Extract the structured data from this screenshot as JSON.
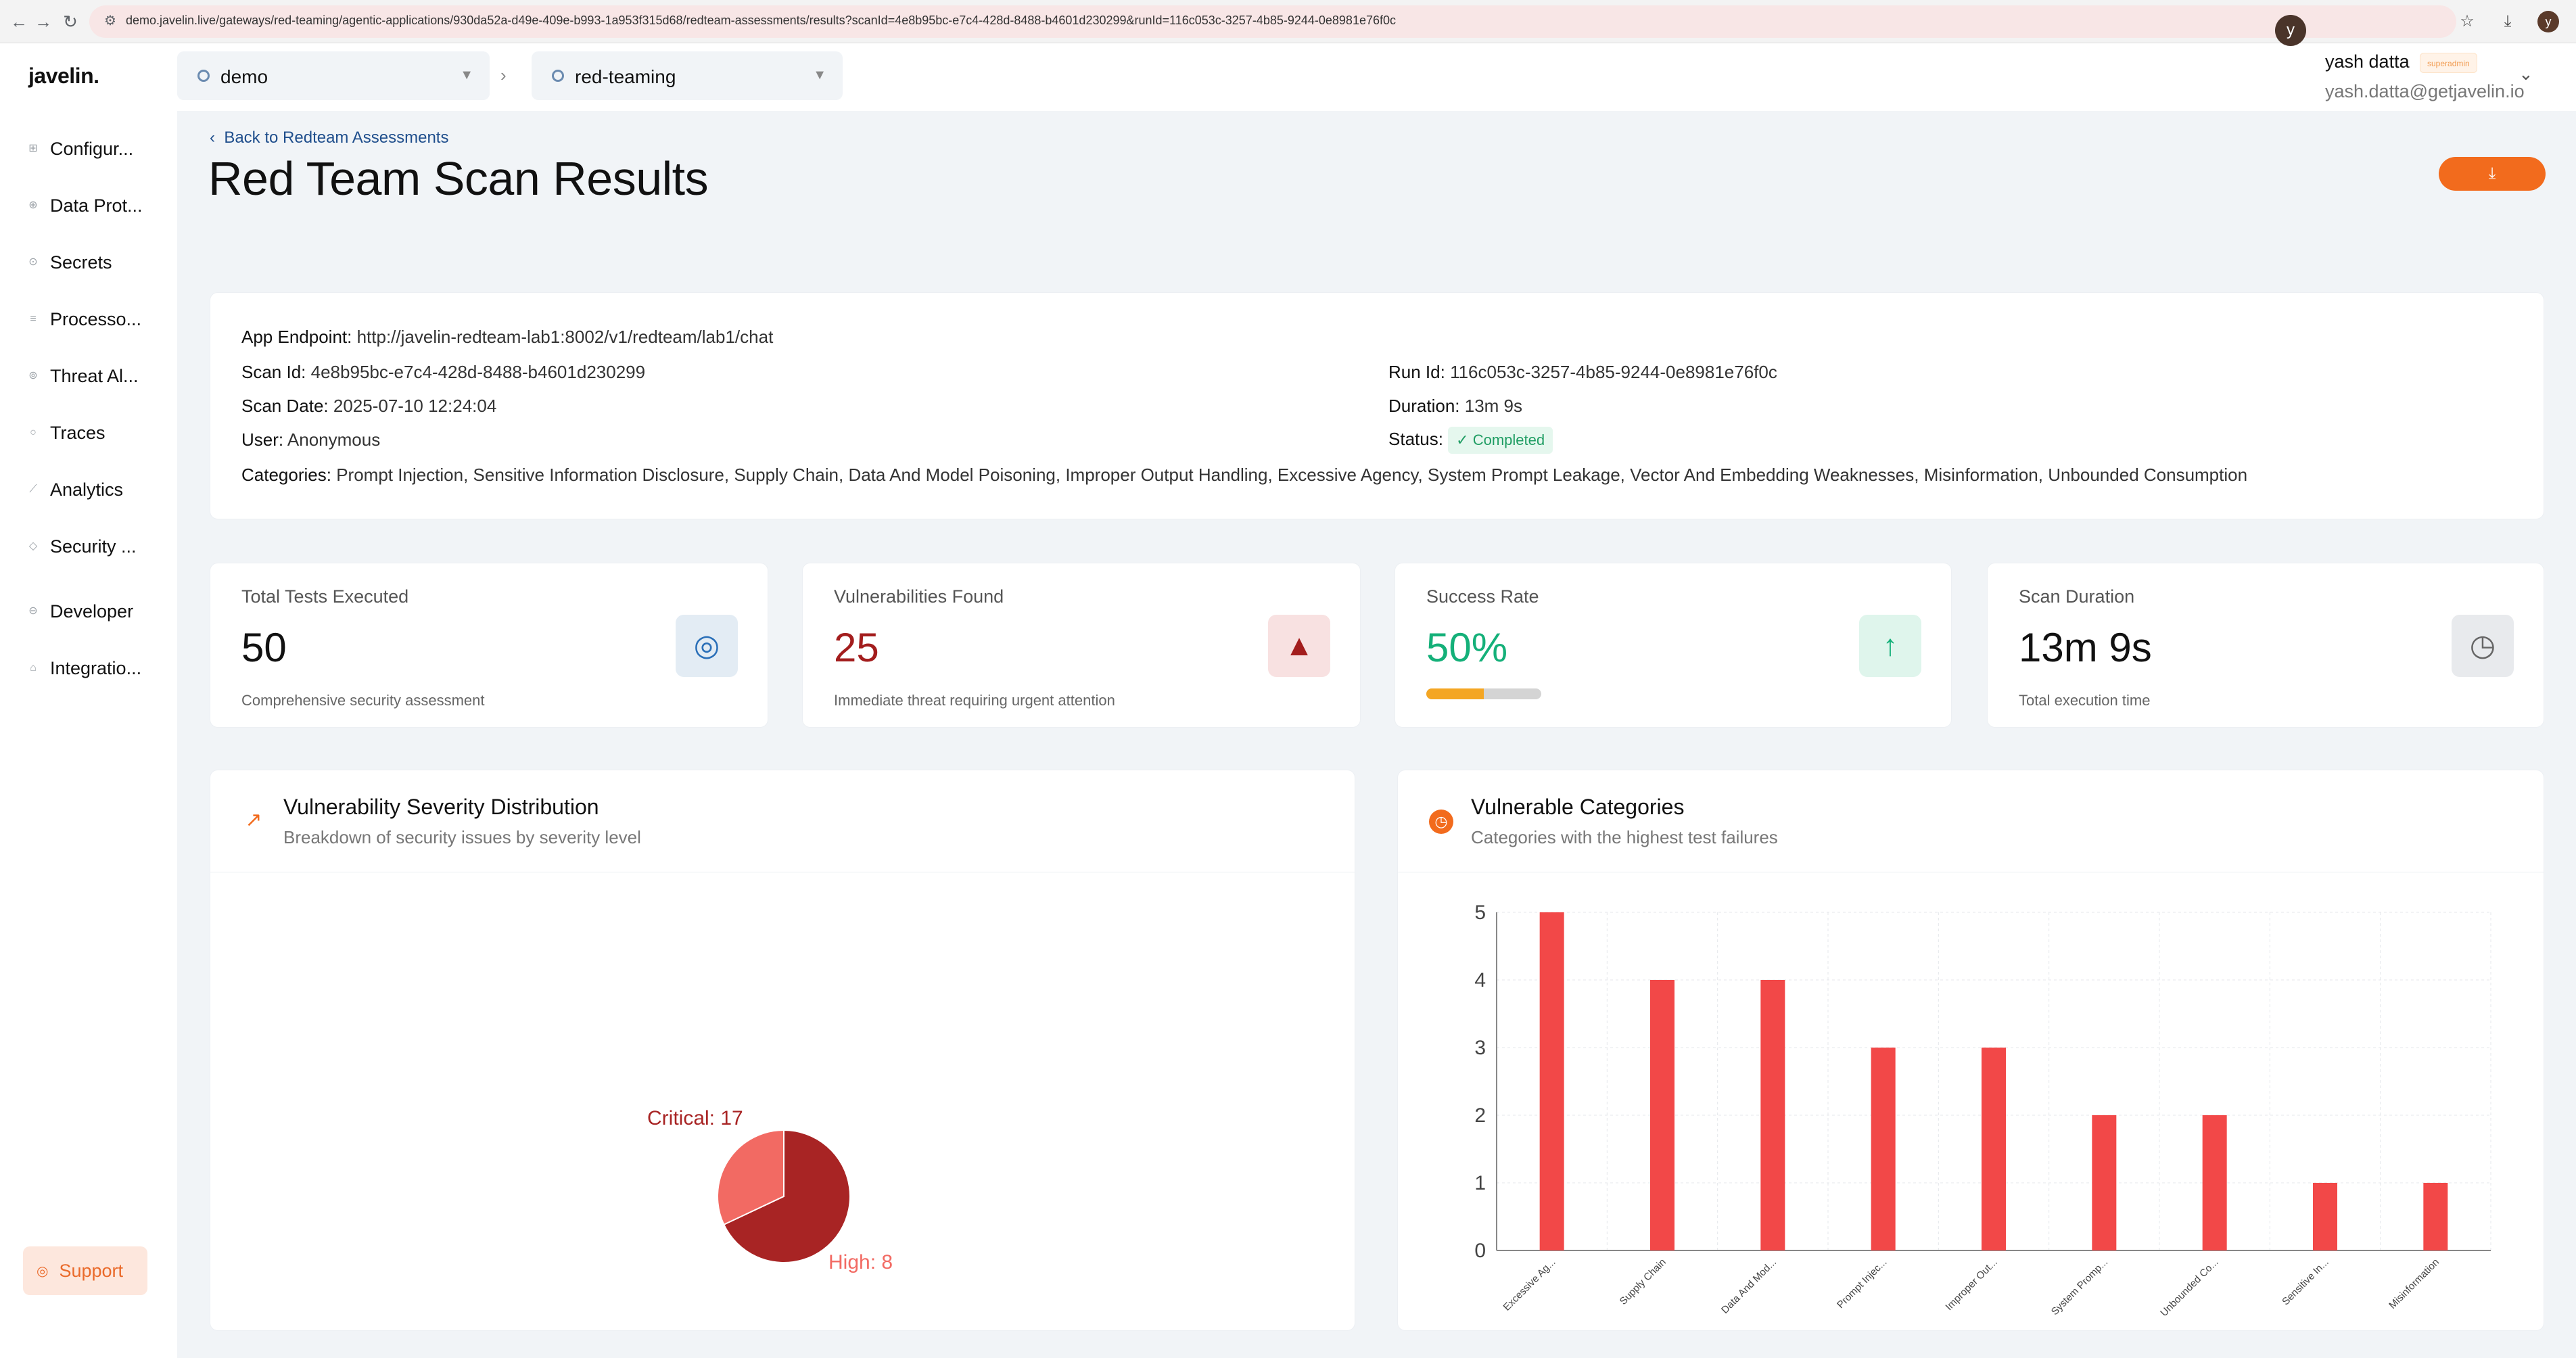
{
  "browser": {
    "url": "demo.javelin.live/gateways/red-teaming/agentic-applications/930da52a-d49e-409e-b993-1a953f315d68/redteam-assessments/results?scanId=4e8b95bc-e7c4-428d-8488-b4601d230299&runId=116c053c-3257-4b85-9244-0e8981e76f0c",
    "profile_initial": "y"
  },
  "app": {
    "logo": "javelin."
  },
  "sidebar": {
    "items": [
      {
        "label": "Configur...",
        "icon": "grid-icon"
      },
      {
        "label": "Data Prot...",
        "icon": "lock-icon"
      },
      {
        "label": "Secrets",
        "icon": "key-icon"
      },
      {
        "label": "Processo...",
        "icon": "list-icon"
      },
      {
        "label": "Threat Al...",
        "icon": "alert-icon"
      },
      {
        "label": "Traces",
        "icon": "trace-icon"
      },
      {
        "label": "Analytics",
        "icon": "chart-icon"
      },
      {
        "label": "Security ...",
        "icon": "shield-icon"
      },
      {
        "label": "Developer",
        "icon": "code-icon"
      },
      {
        "label": "Integratio...",
        "icon": "plug-icon"
      }
    ],
    "support_label": "Support"
  },
  "topbar": {
    "gateway": "demo",
    "application": "red-teaming",
    "user": {
      "initial": "y",
      "name": "yash datta",
      "role": "superadmin",
      "email": "yash.datta@getjavelin.io"
    }
  },
  "header": {
    "back_label": "Back to Redteam Assessments",
    "title": "Red Team Scan Results",
    "download_icon": "download-icon"
  },
  "scan_info": {
    "endpoint_label": "App Endpoint:",
    "endpoint": "http://javelin-redteam-lab1:8002/v1/redteam/lab1/chat",
    "scan_id_label": "Scan Id:",
    "scan_id": "4e8b95bc-e7c4-428d-8488-b4601d230299",
    "scan_date_label": "Scan Date:",
    "scan_date": "2025-07-10 12:24:04",
    "user_label": "User:",
    "user": "Anonymous",
    "run_id_label": "Run Id:",
    "run_id": "116c053c-3257-4b85-9244-0e8981e76f0c",
    "duration_label": "Duration:",
    "duration": "13m 9s",
    "status_label": "Status:",
    "status": "Completed",
    "categories_label": "Categories:",
    "categories": "Prompt Injection, Sensitive Information Disclosure, Supply Chain, Data And Model Poisoning, Improper Output Handling, Excessive Agency, System Prompt Leakage, Vector And Embedding Weaknesses, Misinformation, Unbounded Consumption"
  },
  "stats": [
    {
      "label": "Total Tests Executed",
      "value": "50",
      "sub": "Comprehensive security assessment",
      "icon": "target-icon",
      "value_color": "#111111"
    },
    {
      "label": "Vulnerabilities Found",
      "value": "25",
      "sub": "Immediate threat requiring urgent attention",
      "icon": "warning-icon",
      "value_color": "#a31d1d"
    },
    {
      "label": "Success Rate",
      "value": "50%",
      "progress": 0.5,
      "icon": "arrow-up-icon",
      "value_color": "#14b079"
    },
    {
      "label": "Scan Duration",
      "value": "13m 9s",
      "sub": "Total execution time",
      "icon": "clock-icon",
      "value_color": "#111111"
    }
  ],
  "severity_panel": {
    "title": "Vulnerability Severity Distribution",
    "subtitle": "Breakdown of security issues by severity level",
    "icon": "trend-icon"
  },
  "categories_panel": {
    "title": "Vulnerable Categories",
    "subtitle": "Categories with the highest test failures",
    "icon": "clock-icon"
  },
  "chart_data": [
    {
      "type": "pie",
      "labels": [
        "Critical",
        "High"
      ],
      "values": [
        17,
        8
      ],
      "slice_labels": [
        "Critical: 17",
        "High: 8"
      ],
      "colors": [
        "#a82424",
        "#f26a63"
      ]
    },
    {
      "type": "bar",
      "categories": [
        "Excessive Ag...",
        "Supply Chain",
        "Data And Mod...",
        "Prompt Injec...",
        "Improper Out...",
        "System Promp...",
        "Unbounded Co...",
        "Sensitive In...",
        "Misinformation"
      ],
      "values": [
        5,
        4,
        4,
        3,
        3,
        2,
        2,
        1,
        1
      ],
      "ylim": [
        0,
        5
      ],
      "yticks": [
        "0",
        "1",
        "2",
        "3",
        "4",
        "5"
      ],
      "grid": true,
      "color": "#f24848"
    }
  ]
}
